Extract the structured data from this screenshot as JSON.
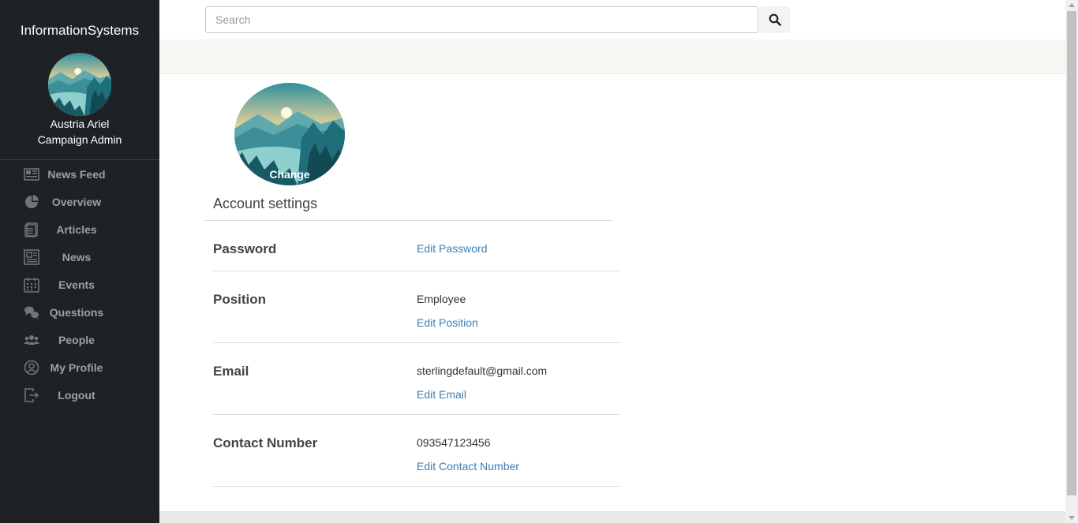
{
  "sidebar": {
    "brand": "InformationSystems",
    "user_name": "Austria Ariel",
    "user_role": "Campaign Admin",
    "items": [
      {
        "label": "News Feed",
        "icon": "newspaper-icon"
      },
      {
        "label": "Overview",
        "icon": "pie-chart-icon"
      },
      {
        "label": "Articles",
        "icon": "documents-icon"
      },
      {
        "label": "News",
        "icon": "news-icon"
      },
      {
        "label": "Events",
        "icon": "calendar-icon"
      },
      {
        "label": "Questions",
        "icon": "chat-bubbles-icon"
      },
      {
        "label": "People",
        "icon": "people-icon"
      },
      {
        "label": "My Profile",
        "icon": "user-circle-icon"
      },
      {
        "label": "Logout",
        "icon": "logout-icon"
      }
    ]
  },
  "search": {
    "placeholder": "Search",
    "value": ""
  },
  "profile": {
    "change_label": "Change"
  },
  "account": {
    "title": "Account settings",
    "rows": [
      {
        "label": "Password",
        "value": "",
        "link": "Edit Password"
      },
      {
        "label": "Position",
        "value": "Employee",
        "link": "Edit Position"
      },
      {
        "label": "Email",
        "value": "sterlingdefault@gmail.com",
        "link": "Edit Email"
      },
      {
        "label": "Contact Number",
        "value": "093547123456",
        "link": "Edit Contact Number"
      }
    ]
  },
  "colors": {
    "sidebar_bg": "#1f2225",
    "link": "#3d7eb3",
    "nav_text": "#9aa0a6"
  }
}
